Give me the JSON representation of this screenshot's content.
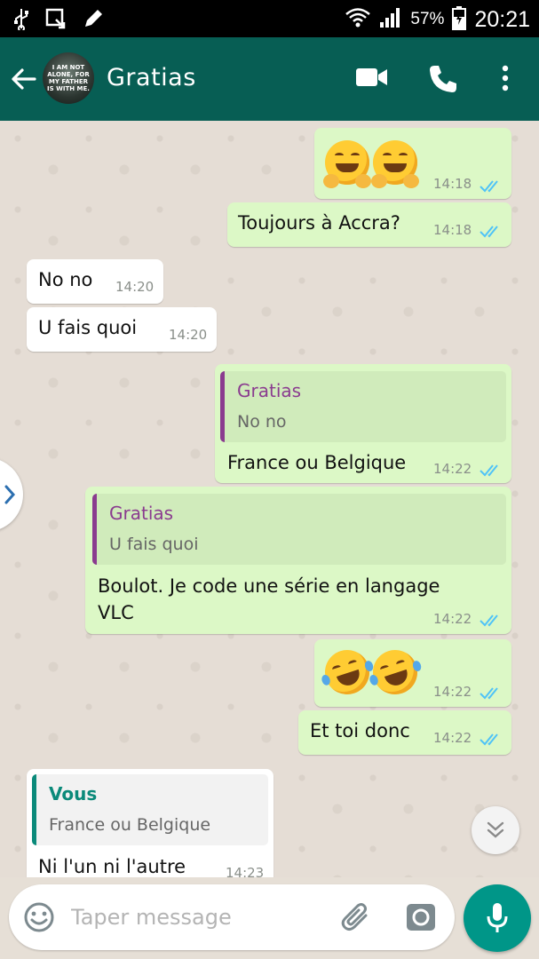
{
  "status_bar": {
    "battery": "57%",
    "time": "20:21",
    "icons": [
      "usb-icon",
      "screen-icon",
      "edit-icon",
      "wifi-icon",
      "signal-icon",
      "battery-icon"
    ]
  },
  "header": {
    "contact_name": "Gratias",
    "avatar_text": "I AM NOT ALONE, FOR MY FATHER IS WITH ME.",
    "icons": [
      "back-arrow-icon",
      "video-call-icon",
      "phone-icon",
      "more-vert-icon"
    ]
  },
  "messages": [
    {
      "direction": "outgoing",
      "content": "🤗🤗",
      "time": "14:18",
      "status": "read"
    },
    {
      "direction": "outgoing",
      "text": "Toujours à Accra?",
      "time": "14:18",
      "status": "read"
    },
    {
      "direction": "incoming",
      "text": "No no",
      "time": "14:20"
    },
    {
      "direction": "incoming",
      "text": "U fais quoi",
      "time": "14:20"
    },
    {
      "direction": "outgoing",
      "quote_name": "Gratias",
      "quote_text": "No no",
      "text": "France ou Belgique",
      "time": "14:22",
      "status": "read"
    },
    {
      "direction": "outgoing",
      "quote_name": "Gratias",
      "quote_text": "U fais quoi",
      "text_line1": "Boulot. Je code une série en langage",
      "text_line2": "VLC",
      "time": "14:22",
      "status": "read"
    },
    {
      "direction": "outgoing",
      "content": "🤣🤣",
      "time": "14:22",
      "status": "read"
    },
    {
      "direction": "outgoing",
      "text": "Et toi donc",
      "time": "14:22",
      "status": "read"
    },
    {
      "direction": "incoming",
      "quote_name": "Vous",
      "quote_text": "France ou Belgique",
      "text": "Ni l'un ni l'autre",
      "time": "14:23"
    }
  ],
  "composer": {
    "placeholder": "Taper message",
    "icons": [
      "emoji-icon",
      "attach-icon",
      "camera-icon",
      "mic-icon"
    ]
  },
  "colors": {
    "header": "#075e54",
    "outgoing_bubble": "#dcf8c6",
    "incoming_bubble": "#ffffff",
    "read_ticks": "#4fc3f7",
    "mic_button": "#009688"
  }
}
